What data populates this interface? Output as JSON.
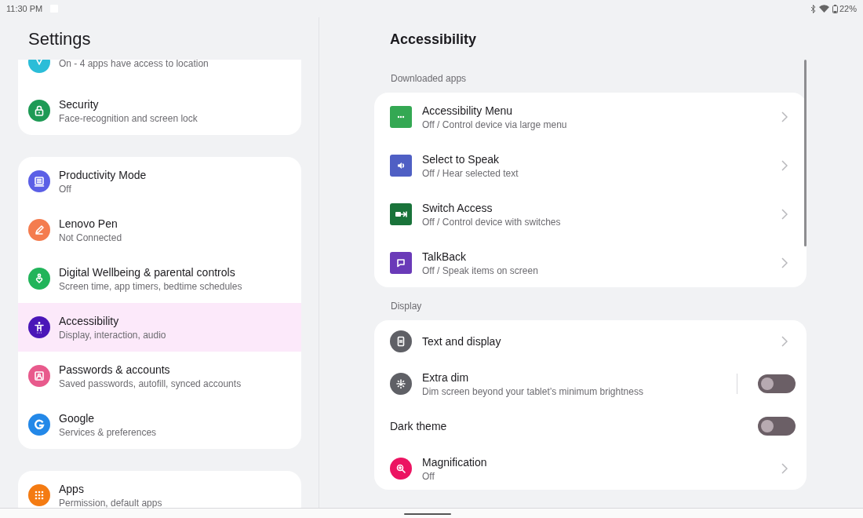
{
  "status_bar": {
    "time": "11:30 PM",
    "battery": "22%"
  },
  "sidebar": {
    "title": "Settings",
    "groups": [
      {
        "items": [
          {
            "subtitle": "On - 4 apps have access to location",
            "color": "#2bbdd8",
            "selected": false
          },
          {
            "title": "Security",
            "subtitle": "Face-recognition and screen lock",
            "color": "#1e9a55",
            "selected": false
          }
        ]
      },
      {
        "items": [
          {
            "title": "Productivity Mode",
            "subtitle": "Off",
            "color": "#5b5fe6",
            "selected": false
          },
          {
            "title": "Lenovo Pen",
            "subtitle": "Not Connected",
            "color": "#f47c4f",
            "selected": false
          },
          {
            "title": "Digital Wellbeing & parental controls",
            "subtitle": "Screen time, app timers, bedtime schedules",
            "color": "#21b45a",
            "selected": false
          },
          {
            "title": "Accessibility",
            "subtitle": "Display, interaction, audio",
            "color": "#4a16b8",
            "selected": true
          },
          {
            "title": "Passwords & accounts",
            "subtitle": "Saved passwords, autofill, synced accounts",
            "color": "#e85a8c",
            "selected": false
          },
          {
            "title": "Google",
            "subtitle": "Services & preferences",
            "color": "#2388e8",
            "selected": false
          }
        ]
      },
      {
        "items": [
          {
            "title": "Apps",
            "subtitle": "Permission, default apps",
            "color": "#f47b12",
            "selected": false
          }
        ]
      }
    ]
  },
  "detail": {
    "title": "Accessibility",
    "sections": [
      {
        "header": "Downloaded apps",
        "items": [
          {
            "kind": "nav",
            "title": "Accessibility Menu",
            "subtitle": "Off / Control device via large menu",
            "color": "#34a853"
          },
          {
            "kind": "nav",
            "title": "Select to Speak",
            "subtitle": "Off / Hear selected text",
            "color": "#4f5fc4"
          },
          {
            "kind": "nav",
            "title": "Switch Access",
            "subtitle": "Off / Control device with switches",
            "color": "#19733a"
          },
          {
            "kind": "nav",
            "title": "TalkBack",
            "subtitle": "Off / Speak items on screen",
            "color": "#6a3ab8"
          }
        ]
      },
      {
        "header": "Display",
        "items": [
          {
            "kind": "nav",
            "title": "Text and display",
            "color": "#5f6066"
          },
          {
            "kind": "toggle",
            "title": "Extra dim",
            "subtitle": "Dim screen beyond your tablet’s minimum brightness",
            "color": "#5f6066",
            "on": false
          },
          {
            "kind": "toggle",
            "title": "Dark theme",
            "on": false
          },
          {
            "kind": "nav",
            "title": "Magnification",
            "subtitle": "Off",
            "color": "#ec1462"
          }
        ]
      }
    ]
  }
}
